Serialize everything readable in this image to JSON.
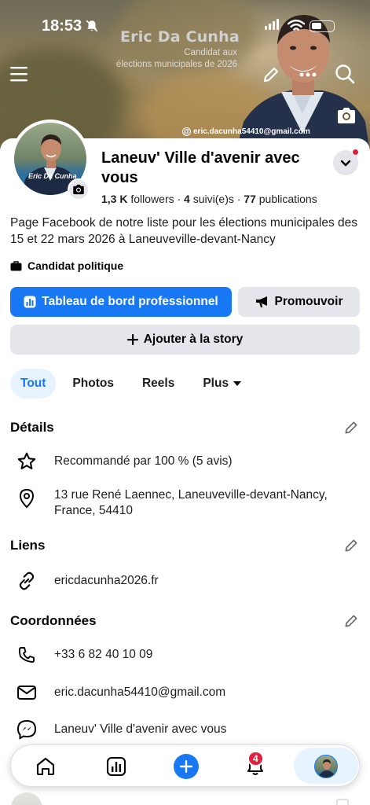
{
  "status_bar": {
    "time": "18:53"
  },
  "cover": {
    "title": "Eric Da Cunha",
    "subtitle_line1": "Candidat aux",
    "subtitle_line2": "élections municipales de 2026",
    "email_overlay": "eric.dacunha54410@gmail.com"
  },
  "avatar": {
    "caption": "Eric Da Cunha"
  },
  "profile": {
    "name": "Laneuv' Ville d'avenir avec vous",
    "followers_count": "1,3 K",
    "followers_label": " followers · ",
    "following_count": "4",
    "following_label": " suivi(e)s · ",
    "posts_count": "77",
    "posts_label": " publications",
    "description": "Page Facebook de notre liste pour les élections municipales des 15 et 22 mars 2026 à Laneuveville-devant-Nancy",
    "category": "Candidat politique"
  },
  "actions": {
    "dashboard": "Tableau de bord professionnel",
    "promote": "Promouvoir",
    "add_story": "Ajouter à la story"
  },
  "tabs": [
    {
      "label": "Tout",
      "active": true
    },
    {
      "label": "Photos"
    },
    {
      "label": "Reels"
    },
    {
      "label": "Plus"
    }
  ],
  "details": {
    "title": "Détails",
    "recommended": "Recommandé par 100 % (5 avis)",
    "address_line1": "13 rue René Laennec, Laneuveville-devant-Nancy,",
    "address_line2": "France, 54410"
  },
  "links": {
    "title": "Liens",
    "website": "ericdacunha2026.fr"
  },
  "contact": {
    "title": "Coordonnées",
    "phone": "+33 6 82 40 10 09",
    "email": "eric.dacunha54410@gmail.com",
    "messenger": "Laneuv' Ville d'avenir avec vous"
  },
  "nav": {
    "notifications_badge": "4"
  },
  "colors": {
    "accent": "#1877f2",
    "badge": "#e41e3f",
    "button_gray": "#e4e6eb"
  }
}
